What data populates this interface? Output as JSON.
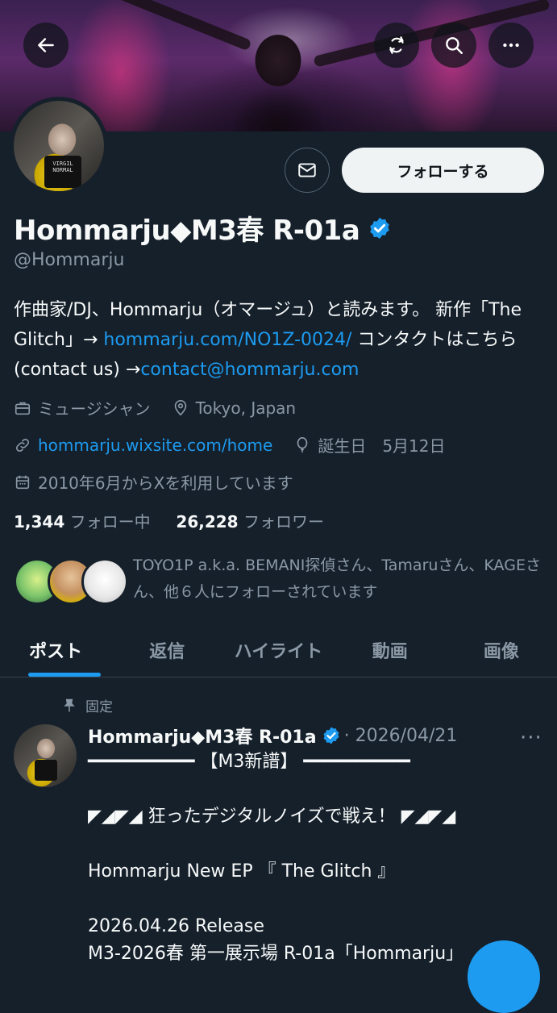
{
  "header": {
    "back_label": "back",
    "buttons": [
      "refresh",
      "search",
      "more"
    ]
  },
  "profile": {
    "avatar_shirt_text": "VIRGIL NORMAL",
    "follow_label": "フォローする",
    "name": "Hommarju◆M3春 R-01a",
    "handle": "@Hommarju",
    "bio": {
      "part1": "作曲家/DJ、Hommarju（オマージュ）と読みます。 新作「The Glitch」→ ",
      "link1": "hommarju.com/NO1Z-0024/",
      "part2": " コンタクトはこちら (contact us) →",
      "link2": "contact@hommarju.com"
    },
    "category": "ミュージシャン",
    "location": "Tokyo, Japan",
    "website": "hommarju.wixsite.com/home",
    "birthday": "誕生日　5月12日",
    "joined": "2010年6月からXを利用しています",
    "following_count": "1,344",
    "following_label": "フォロー中",
    "followers_count": "26,228",
    "followers_label": "フォロワー",
    "followed_by": "TOYO1P a.k.a. BEMANI探偵さん、Tamaruさん、KAGEさん、他６人にフォローされています"
  },
  "tabs": [
    "ポスト",
    "返信",
    "ハイライト",
    "動画",
    "画像"
  ],
  "post": {
    "pinned_label": "固定",
    "author": "Hommarju◆M3春 R-01a",
    "date": "· 2026/04/21",
    "more": "···",
    "text": "━━━━━━━━━━ 【M3新譜】 ━━━━━━━━━━\n\n◤◢◤◢ 狂ったデジタルノイズで戦え！ ◤◢◤◢\n\nHommarju New EP 『 The Glitch 』\n\n2026.04.26 Release\nM3-2026春 第一展示場 R-01a「Hommarju」"
  },
  "colors": {
    "background": "#15202b",
    "accent": "#1d9bf0",
    "muted": "#8b98a5"
  }
}
